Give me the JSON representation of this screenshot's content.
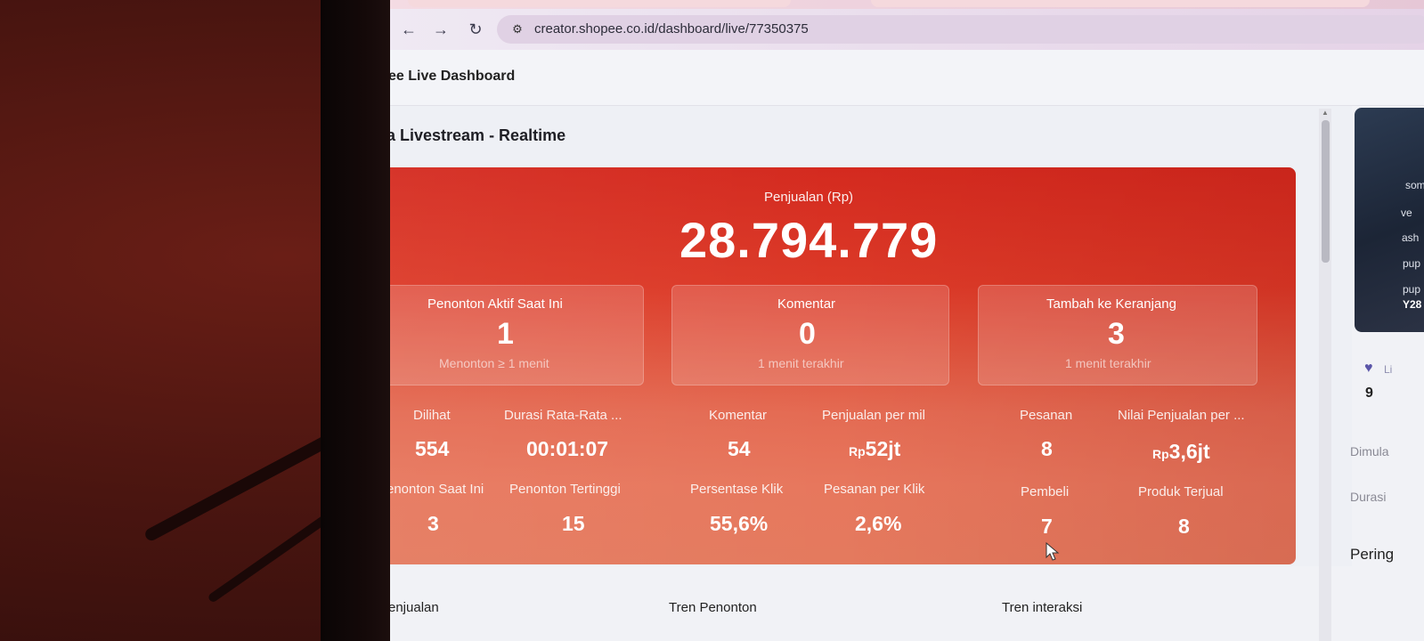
{
  "browser": {
    "url": "creator.shopee.co.id/dashboard/live/77350375"
  },
  "app": {
    "title": "ee Live Dashboard"
  },
  "page": {
    "title": "a Livestream - Realtime"
  },
  "sales": {
    "label": "Penjualan (Rp)",
    "value": "28.794.779"
  },
  "cards": [
    {
      "label": "Penonton Aktif Saat Ini",
      "value": "1",
      "sub": "Menonton ≥ 1 menit"
    },
    {
      "label": "Komentar",
      "value": "0",
      "sub": "1 menit terakhir"
    },
    {
      "label": "Tambah ke Keranjang",
      "value": "3",
      "sub": "1 menit terakhir"
    }
  ],
  "metrics": {
    "row1": [
      {
        "label": "Dilihat",
        "value": "554"
      },
      {
        "label": "Durasi Rata-Rata ...",
        "value": "00:01:07"
      },
      {
        "label": "Komentar",
        "value": "54"
      },
      {
        "label": "Penjualan per mil",
        "prefix": "Rp",
        "value": "52jt"
      },
      {
        "label": "Pesanan",
        "value": "8"
      },
      {
        "label": "Nilai Penjualan per ...",
        "prefix": "Rp",
        "value": "3,6jt"
      }
    ],
    "row2": [
      {
        "label": "enonton Saat Ini",
        "value": "3"
      },
      {
        "label": "Penonton Tertinggi",
        "value": "15"
      },
      {
        "label": "Persentase Klik",
        "value": "55,6%"
      },
      {
        "label": "Pesanan per Klik",
        "value": "2,6%"
      },
      {
        "label": "Pembeli",
        "value": "7"
      },
      {
        "label": "Produk Terjual",
        "value": "8"
      }
    ]
  },
  "bottom_tabs": [
    "enjualan",
    "Tren Penonton",
    "Tren interaksi"
  ],
  "right_panel": {
    "thumb_lines": [
      "som",
      "ve",
      "ash",
      "pup",
      "pup",
      "Y28"
    ],
    "like_label": "Li",
    "like_count": "9",
    "dimulai": "Dimula",
    "durasi": "Durasi",
    "peringkat": "Pering"
  }
}
